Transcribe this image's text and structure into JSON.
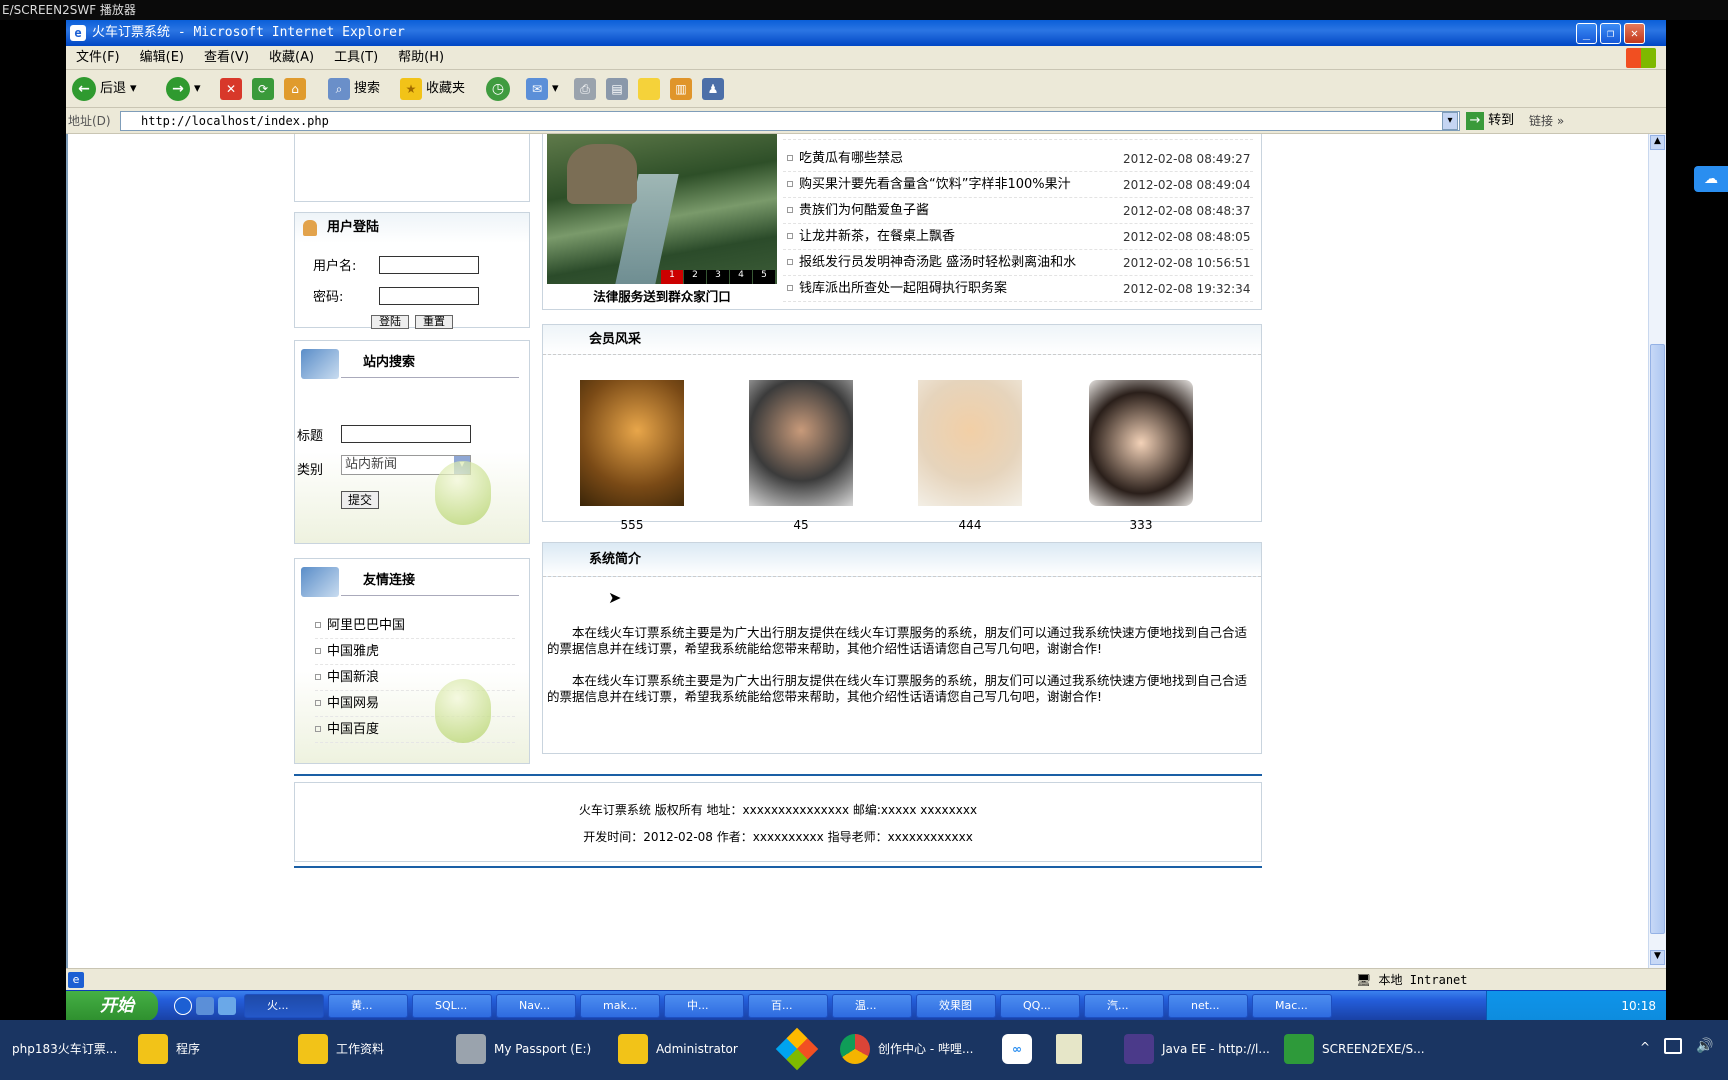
{
  "player": {
    "title": "E/SCREEN2SWF 播放器"
  },
  "ie": {
    "title": "火车订票系统 - Microsoft Internet Explorer",
    "menu": [
      "文件(F)",
      "编辑(E)",
      "查看(V)",
      "收藏(A)",
      "工具(T)",
      "帮助(H)"
    ],
    "toolbar": {
      "back": "后退",
      "search": "搜索",
      "favorites": "收藏夹"
    },
    "address_label": "地址(D)",
    "url": "http://localhost/index.php",
    "go": "转到",
    "links": "链接",
    "status_zone": "本地 Intranet"
  },
  "page": {
    "login": {
      "title": "用户登陆",
      "username_label": "用户名:",
      "password_label": "密码:",
      "login_btn": "登陆",
      "reset_btn": "重置"
    },
    "search": {
      "title": "站内搜索",
      "title_label": "标题",
      "category_label": "类别",
      "category_value": "站内新闻",
      "submit": "提交"
    },
    "friends": {
      "title": "友情连接",
      "items": [
        "阿里巴巴中国",
        "中国雅虎",
        "中国新浪",
        "中国网易",
        "中国百度"
      ]
    },
    "slideshow": {
      "caption": "法律服务送到群众家门口",
      "pages": [
        "1",
        "2",
        "3",
        "4",
        "5"
      ]
    },
    "news": [
      {
        "title": "吃黄瓜有哪些禁忌",
        "date": "2012-02-08 08:49:27"
      },
      {
        "title": "购买果汁要先看含量含“饮料”字样非100%果汁",
        "date": "2012-02-08 08:49:04"
      },
      {
        "title": "贵族们为何酷爱鱼子酱",
        "date": "2012-02-08 08:48:37"
      },
      {
        "title": "让龙井新茶，在餐桌上飘香",
        "date": "2012-02-08 08:48:05"
      },
      {
        "title": "报纸发行员发明神奇汤匙 盛汤时轻松剥离油和水",
        "date": "2012-02-08 10:56:51"
      },
      {
        "title": "钱库派出所查处一起阻碍执行职务案",
        "date": "2012-02-08 19:32:34"
      }
    ],
    "members": {
      "title": "会员风采",
      "names": [
        "555",
        "45",
        "444",
        "333"
      ]
    },
    "intro": {
      "title": "系统简介",
      "para1": "本在线火车订票系统主要是为广大出行朋友提供在线火车订票服务的系统，朋友们可以通过我系统快速方便地找到自己合适的票据信息并在线订票，希望我系统能给您带来帮助，其他介绍性话语请您自己写几句吧，谢谢合作!",
      "para2": "本在线火车订票系统主要是为广大出行朋友提供在线火车订票服务的系统，朋友们可以通过我系统快速方便地找到自己合适的票据信息并在线订票，希望我系统能给您带来帮助，其他介绍性话语请您自己写几句吧，谢谢合作!"
    },
    "footer": {
      "line1": "火车订票系统 版权所有 地址：xxxxxxxxxxxxxxx 邮编:xxxxx xxxxxxxx",
      "line2": "开发时间：2012-02-08 作者：xxxxxxxxxx 指导老师：xxxxxxxxxxxx"
    }
  },
  "xp_taskbar": {
    "start": "开始",
    "tasks": [
      "火...",
      "黄...",
      "SQL...",
      "Nav...",
      "mak...",
      "中...",
      "百...",
      "温...",
      "效果图",
      "QQ...",
      "汽...",
      "net...",
      "Mac..."
    ],
    "clock": "10:18"
  },
  "host_taskbar": {
    "items": [
      "php183火车订票...",
      "程序",
      "工作资料",
      "My Passport (E:)",
      "Administrator",
      "创作中心 - 哔哩...",
      "Java EE - http://l...",
      "SCREEN2EXE/S..."
    ]
  }
}
